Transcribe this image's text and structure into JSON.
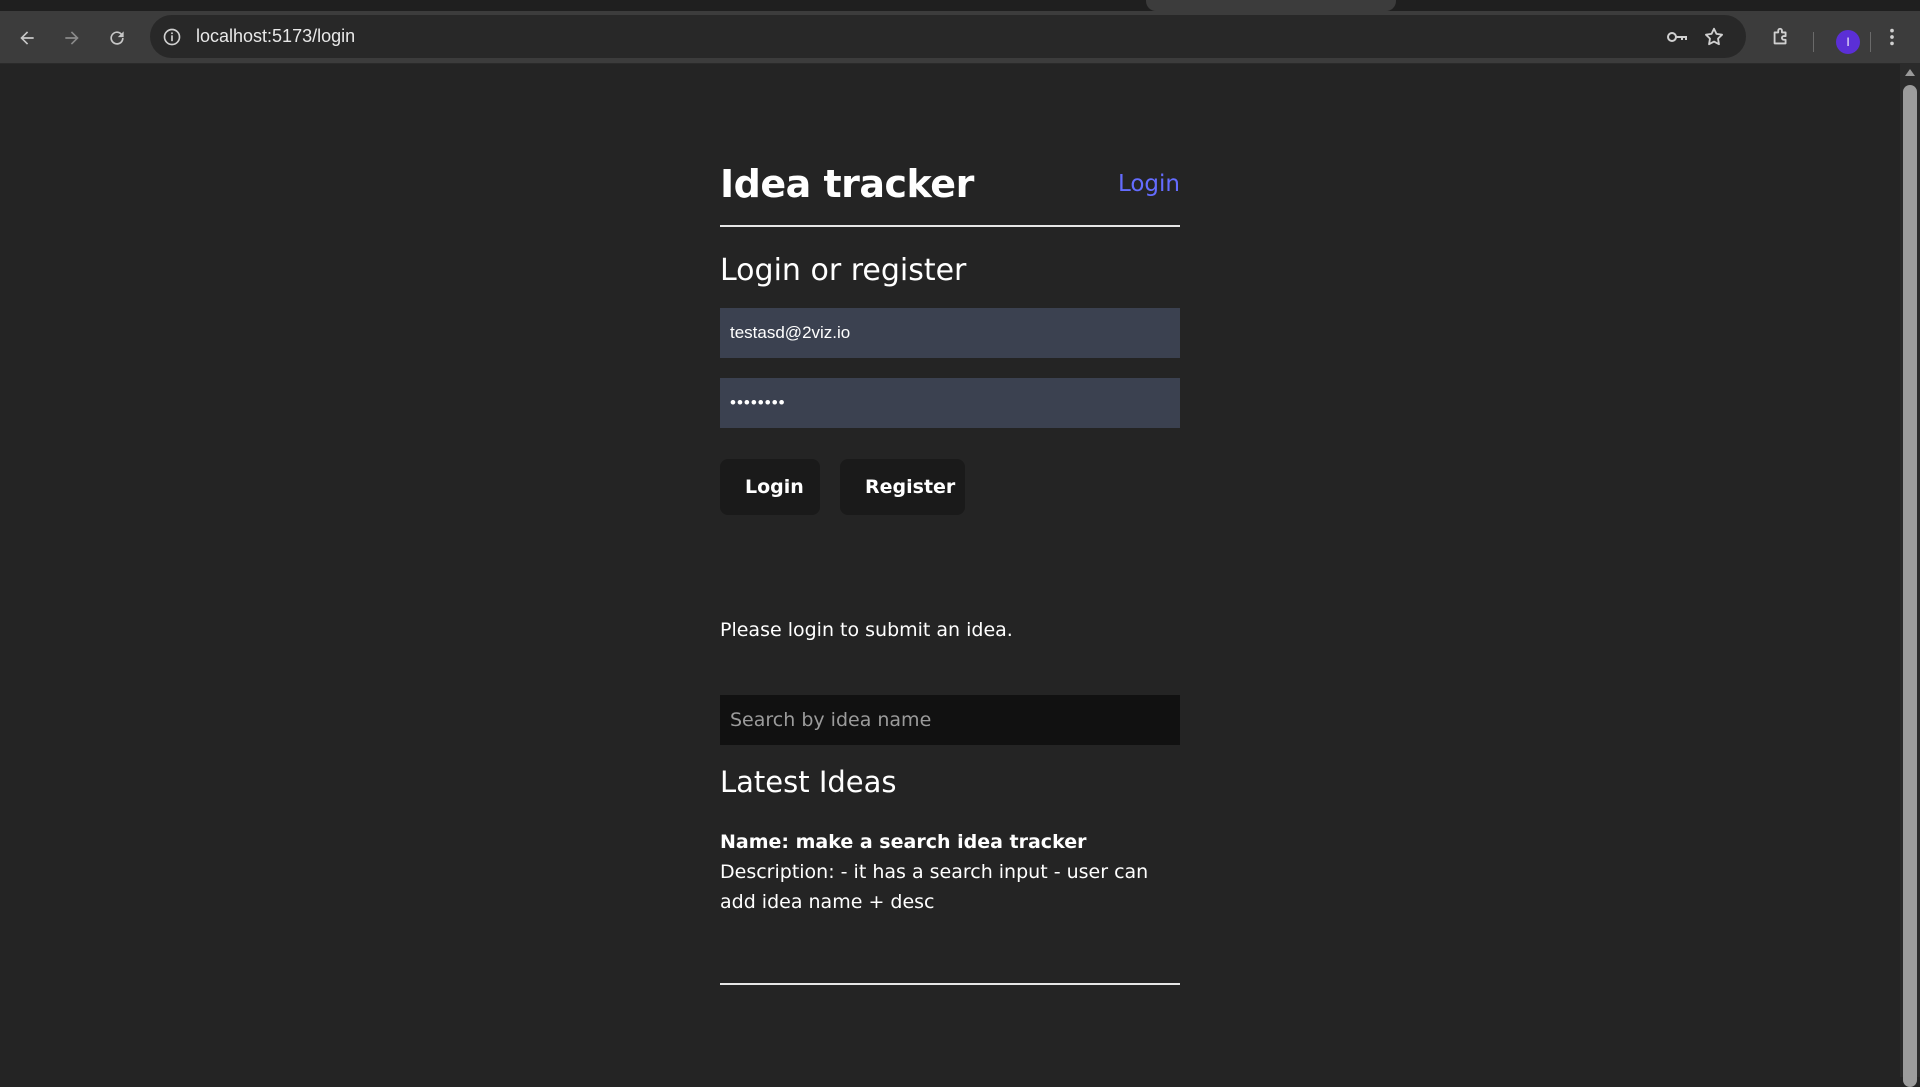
{
  "browser": {
    "url": "localhost:5173/login",
    "profile_initial": "I",
    "icons": {
      "back": "arrow-left-icon",
      "forward": "arrow-right-icon",
      "reload": "reload-icon",
      "info": "info-icon",
      "password": "key-icon",
      "bookmark": "star-icon",
      "extensions": "puzzle-icon",
      "menu": "kebab-menu-icon"
    }
  },
  "header": {
    "title": "Idea tracker",
    "nav_login": "Login"
  },
  "auth": {
    "heading": "Login or register",
    "email_value": "testasd@2viz.io",
    "password_value": "••••••••",
    "login_label": "Login",
    "register_label": "Register"
  },
  "notice": "Please login to submit an idea.",
  "search": {
    "placeholder": "Search by idea name"
  },
  "ideas": {
    "heading": "Latest Ideas",
    "items": [
      {
        "name": "Name: make a search idea tracker",
        "description": "Description: - it has a search input - user can add idea name + desc"
      }
    ]
  },
  "colors": {
    "page_bg": "#242424",
    "accent_link": "#646cff",
    "input_bg": "#3b4150",
    "button_bg": "#1a1a1a"
  }
}
